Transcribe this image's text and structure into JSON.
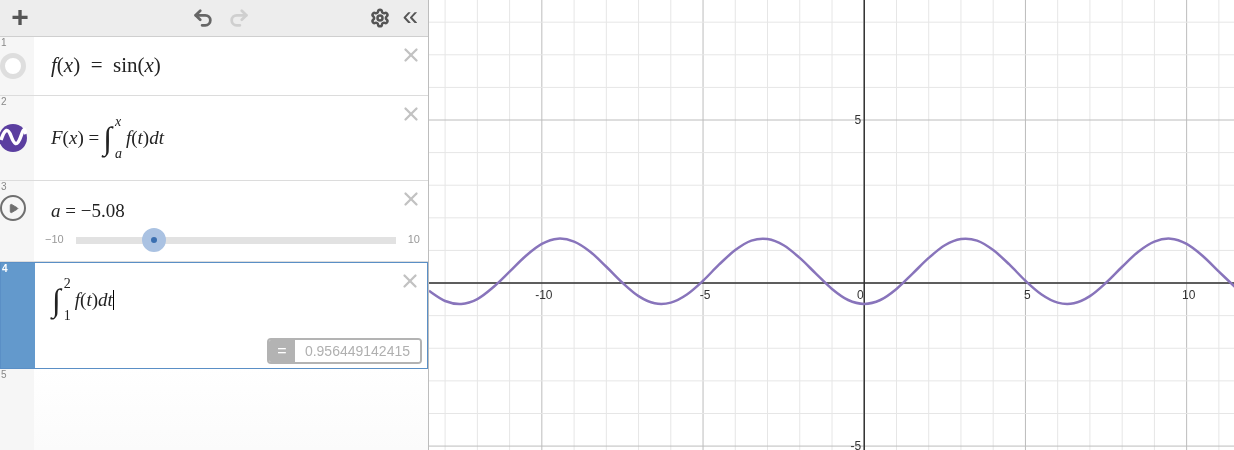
{
  "toolbar": {
    "add": "+",
    "undo_enabled": true,
    "redo_enabled": false,
    "collapse": "«"
  },
  "expressions": [
    {
      "number": "1",
      "kind": "plain",
      "selected": false,
      "math": "*f*(*x*)  =  sin(*x*)"
    },
    {
      "number": "2",
      "kind": "integral",
      "color": "#5b3fa0",
      "selected": false,
      "lhs": "*F*(*x*) =",
      "symbol": "∫",
      "upper": "*x*",
      "lower": "*a*",
      "integrand": "*f*(*t*)*dt*"
    },
    {
      "number": "3",
      "kind": "slider",
      "selected": false,
      "math": "*a* = −5.08",
      "min": "−10",
      "max": "10",
      "level": 0.246
    },
    {
      "number": "4",
      "kind": "integral",
      "selected": true,
      "symbol": "∫",
      "upper": "2",
      "lower": "1",
      "integrand": "*f*(*t*)*dt*",
      "result_sign": "=",
      "result": "0.956449142415"
    },
    {
      "number": "5",
      "kind": "empty",
      "selected": false
    }
  ],
  "graph": {
    "chart_data": {
      "type": "line",
      "grid": true,
      "xlim": [
        -13.5,
        11.5
      ],
      "ylim": [
        -5.12,
        8.68
      ],
      "xticks": [
        -10,
        -5,
        0,
        5,
        10
      ],
      "yticks": [
        -5,
        5
      ],
      "x": [
        -13.5,
        -13,
        -12.5,
        -12,
        -11.5,
        -11,
        -10.5,
        -10,
        -9.5,
        -9,
        -8.5,
        -8,
        -7.5,
        -7,
        -6.5,
        -6,
        -5.5,
        -5,
        -4.5,
        -4,
        -3.5,
        -3,
        -2.5,
        -2,
        -1.5,
        -1,
        -0.5,
        0,
        0.5,
        1,
        1.5,
        2,
        2.5,
        3,
        3.5,
        4,
        4.5,
        5,
        5.5,
        6,
        6.5,
        7,
        7.5,
        8,
        8.5,
        9,
        9.5,
        10,
        10.5,
        11,
        11.5
      ],
      "series": [
        {
          "color": "#8874bb",
          "values": [
            -0.24,
            -0.55,
            -0.64,
            -0.49,
            -0.12,
            0.35,
            0.83,
            1.2,
            1.36,
            1.27,
            0.96,
            0.5,
            0.01,
            -0.4,
            -0.62,
            -0.6,
            -0.35,
            0.07,
            0.57,
            1.01,
            1.3,
            1.35,
            1.16,
            0.77,
            0.29,
            -0.18,
            -0.52,
            -0.64,
            -0.52,
            -0.18,
            0.29,
            0.77,
            1.16,
            1.35,
            1.3,
            1.01,
            0.57,
            0.07,
            -0.35,
            -0.6,
            -0.62,
            -0.4,
            0.01,
            0.5,
            0.96,
            1.27,
            1.36,
            1.2,
            0.83,
            0.35,
            -0.12
          ]
        }
      ]
    }
  }
}
